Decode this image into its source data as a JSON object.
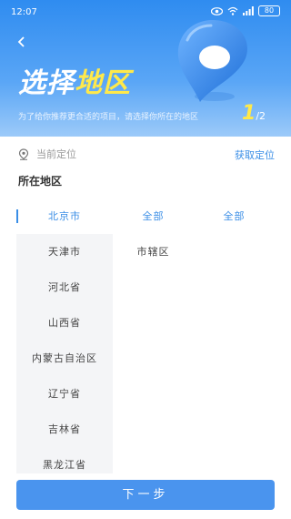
{
  "status": {
    "time": "12:07",
    "battery": "80"
  },
  "header": {
    "title_part1": "选择",
    "title_part2": "地区",
    "subtitle": "为了给你推荐更合适的项目，请选择你所在的地区",
    "step_current": "1",
    "step_total": "/2"
  },
  "location": {
    "label": "当前定位",
    "action": "获取定位"
  },
  "section_title": "所在地区",
  "provinces": [
    {
      "label": "北京市",
      "selected": true
    },
    {
      "label": "天津市"
    },
    {
      "label": "河北省"
    },
    {
      "label": "山西省"
    },
    {
      "label": "内蒙古自治区"
    },
    {
      "label": "辽宁省"
    },
    {
      "label": "吉林省"
    },
    {
      "label": "黑龙江省"
    }
  ],
  "cities": [
    {
      "label": "全部",
      "selected": true
    },
    {
      "label": "市辖区"
    }
  ],
  "districts": [
    {
      "label": "全部",
      "selected": true
    }
  ],
  "next_button": "下一步",
  "colors": {
    "primary": "#4a94ee",
    "accent": "#ffe94a",
    "link": "#3a8ee6"
  }
}
